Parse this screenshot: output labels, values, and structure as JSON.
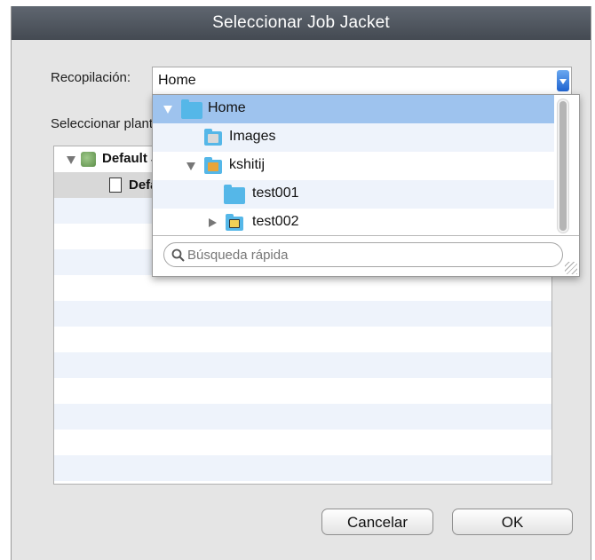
{
  "dialog": {
    "title": "Seleccionar Job Jacket"
  },
  "collection": {
    "label": "Recopilación:",
    "value": "Home"
  },
  "select_label": "Seleccionar plantilla de tickets de trabajo",
  "tree": [
    {
      "label": "Default Job Jackets",
      "expanded": true,
      "level": 0
    },
    {
      "label": "Default Job Jacket",
      "level": 1,
      "selected": true
    }
  ],
  "popup": {
    "items": [
      {
        "label": "Home",
        "expanded": true,
        "selected": true,
        "icon": "folder-icon"
      },
      {
        "label": "Images",
        "icon": "images-folder-icon"
      },
      {
        "label": "kshitij",
        "expanded": true,
        "icon": "user-home-folder-icon"
      },
      {
        "label": "test001",
        "icon": "folder-icon"
      },
      {
        "label": "test002",
        "expanded": false,
        "icon": "monitor-folder-icon"
      }
    ],
    "search_placeholder": "Búsqueda rápida"
  },
  "buttons": {
    "cancel": "Cancelar",
    "ok": "OK"
  },
  "colors": {
    "selection": "#9ec3ee",
    "title_bar": "#4e545c",
    "folder": "#55b7e8"
  }
}
